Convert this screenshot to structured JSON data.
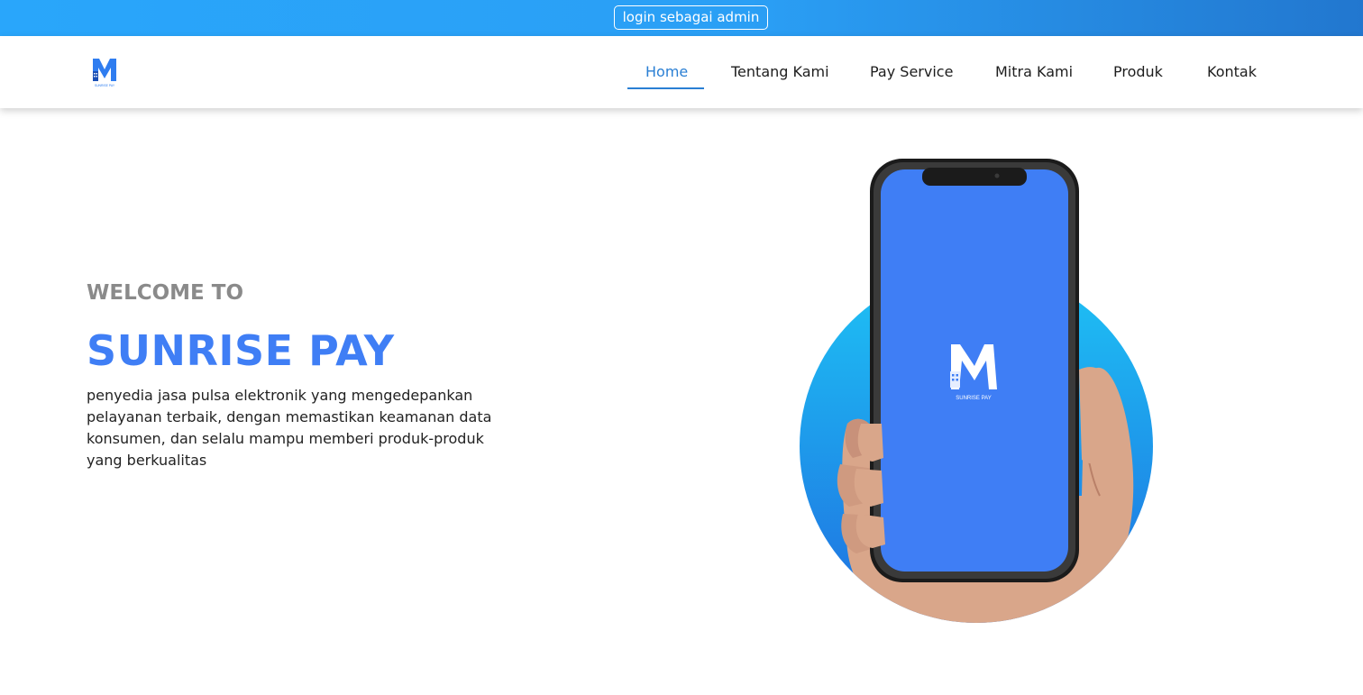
{
  "topbar": {
    "admin_label": "login sebagai admin"
  },
  "navbar": {
    "logo_text": "SUNRISE PAY",
    "items": [
      {
        "label": "Home",
        "active": true
      },
      {
        "label": "Tentang Kami",
        "active": false
      },
      {
        "label": "Pay Service",
        "active": false
      },
      {
        "label": "Mitra Kami",
        "active": false
      },
      {
        "label": "Produk",
        "active": false
      },
      {
        "label": "Kontak",
        "active": false
      }
    ]
  },
  "hero": {
    "welcome": "WELCOME TO",
    "title": "SUNRISE PAY",
    "description": "penyedia jasa pulsa elektronik yang mengedepankan pelayanan terbaik, dengan memastikan keamanan data konsumen, dan selalu mampu memberi  produk-produk yang berkualitas",
    "phone_logo_text": "SUNRISE PAY"
  },
  "colors": {
    "brand_blue": "#3f7ef5",
    "topbar_start": "#29a6fb",
    "topbar_end": "#2277cf",
    "nav_active": "#2a7fd4",
    "circle_top": "#1ec3f5",
    "circle_bottom": "#1f6fe0"
  }
}
